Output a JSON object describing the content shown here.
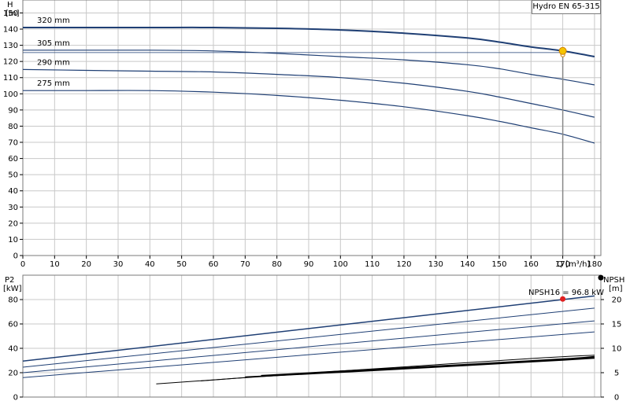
{
  "title": "Hydro EN 65-315",
  "npsh_note": "NPSH16 = 96.8 kW",
  "colors": {
    "curve": "#1f3f74",
    "npsh": "#000000",
    "duty_point": "#f5c400",
    "power_point": "#e02020",
    "grid": "#c8c8c8"
  },
  "chart_data": [
    {
      "type": "line",
      "ylabel": "H",
      "yunit": "[m]",
      "xlabel": "Q [m³/h]",
      "xlim": [
        0,
        182
      ],
      "ylim": [
        0,
        158
      ],
      "x_ticks": [
        "0",
        "10",
        "20",
        "30",
        "40",
        "50",
        "60",
        "70",
        "80",
        "90",
        "100",
        "110",
        "120",
        "130",
        "140",
        "150",
        "160",
        "170",
        "180"
      ],
      "y_ticks": [
        "0",
        "10",
        "20",
        "30",
        "40",
        "50",
        "60",
        "70",
        "80",
        "90",
        "100",
        "110",
        "120",
        "130",
        "140",
        "150"
      ],
      "grid": true,
      "series": [
        {
          "name": "320 mm",
          "x": [
            0,
            20,
            40,
            60,
            80,
            100,
            120,
            140,
            150,
            160,
            170,
            180
          ],
          "y": [
            141,
            141,
            141,
            141,
            140.5,
            139.5,
            137.5,
            134.5,
            132,
            129,
            126.5,
            123
          ]
        },
        {
          "name": "305 mm",
          "x": [
            0,
            20,
            40,
            60,
            80,
            100,
            120,
            140,
            150,
            160,
            170,
            180
          ],
          "y": [
            127,
            127,
            127,
            126.5,
            125,
            123,
            121,
            118,
            115.5,
            112,
            109,
            105.5
          ]
        },
        {
          "name": "290 mm",
          "x": [
            0,
            20,
            40,
            60,
            80,
            100,
            120,
            140,
            150,
            160,
            170,
            180
          ],
          "y": [
            115,
            114.5,
            114,
            113.5,
            112,
            110,
            106.5,
            101.5,
            98,
            94,
            90,
            85.5
          ]
        },
        {
          "name": "275 mm",
          "x": [
            0,
            20,
            40,
            60,
            80,
            100,
            120,
            140,
            150,
            160,
            170,
            180
          ],
          "y": [
            102,
            102,
            102,
            101,
            99,
            96,
            92,
            86.5,
            83,
            79,
            75,
            69.5
          ]
        }
      ],
      "duty_point": {
        "x": 170,
        "y": 126.5
      },
      "reference_line_y": 125.5
    },
    {
      "type": "line",
      "ylabel": "P2",
      "yunit": "[kW]",
      "y2label": "NPSH",
      "y2unit": "[m]",
      "xlim": [
        0,
        182
      ],
      "ylim": [
        0,
        100
      ],
      "y2lim": [
        0,
        25
      ],
      "y_ticks": [
        "0",
        "20",
        "40",
        "60",
        "80"
      ],
      "y2_ticks": [
        "0",
        "5",
        "10",
        "15",
        "20"
      ],
      "grid": true,
      "power_series": [
        {
          "x": [
            0,
            180
          ],
          "y": [
            29.5,
            83
          ]
        },
        {
          "x": [
            0,
            180
          ],
          "y": [
            24.5,
            73
          ]
        },
        {
          "x": [
            0,
            180
          ],
          "y": [
            20,
            62.5
          ]
        },
        {
          "x": [
            0,
            180
          ],
          "y": [
            16,
            53.5
          ]
        }
      ],
      "npsh_series": [
        {
          "x": [
            42,
            80,
            120,
            160,
            180
          ],
          "y": [
            2.7,
            4.4,
            5.9,
            7.4,
            8.1
          ]
        },
        {
          "x": [
            56,
            80,
            120,
            160,
            180
          ],
          "y": [
            3.3,
            4.5,
            6.2,
            7.9,
            8.6
          ]
        },
        {
          "x": [
            70,
            100,
            140,
            170,
            180
          ],
          "y": [
            4.1,
            5.1,
            6.5,
            7.6,
            8.0
          ]
        },
        {
          "x": [
            75,
            100,
            140,
            170,
            180
          ],
          "y": [
            4.4,
            5.3,
            6.7,
            7.8,
            8.3
          ]
        }
      ],
      "power_point": {
        "x": 170,
        "y": 80.5
      },
      "npsh_marker": {
        "y": 24.5
      }
    }
  ]
}
